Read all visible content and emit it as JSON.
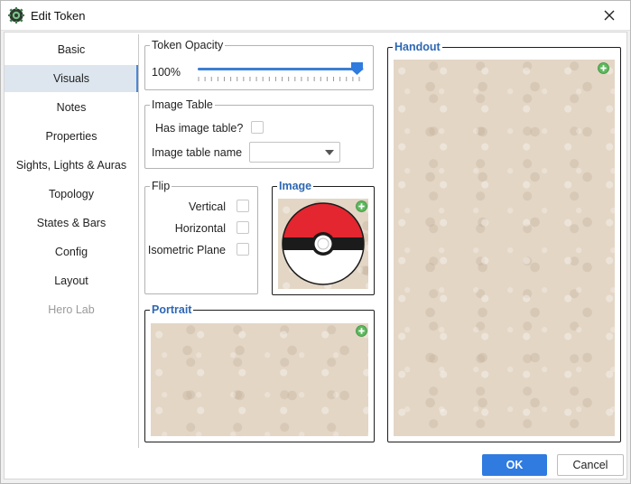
{
  "window": {
    "title": "Edit Token"
  },
  "sidebar": {
    "items": [
      {
        "label": "Basic"
      },
      {
        "label": "Visuals"
      },
      {
        "label": "Notes"
      },
      {
        "label": "Properties"
      },
      {
        "label": "Sights, Lights & Auras"
      },
      {
        "label": "Topology"
      },
      {
        "label": "States & Bars"
      },
      {
        "label": "Config"
      },
      {
        "label": "Layout"
      },
      {
        "label": "Hero Lab"
      }
    ],
    "active": "Visuals",
    "disabled": [
      "Hero Lab"
    ]
  },
  "opacity": {
    "title": "Token Opacity",
    "value_label": "100%",
    "value": 1.0
  },
  "image_table": {
    "title": "Image Table",
    "has_label": "Has image table?",
    "has_checked": false,
    "name_label": "Image table name",
    "name_value": ""
  },
  "flip": {
    "title": "Flip",
    "vertical_label": "Vertical",
    "horizontal_label": "Horizontal",
    "isometric_label": "Isometric Plane",
    "vertical_checked": false,
    "horizontal_checked": false,
    "isometric_checked": false
  },
  "image": {
    "title": "Image"
  },
  "portrait": {
    "title": "Portrait"
  },
  "handout": {
    "title": "Handout"
  },
  "buttons": {
    "ok": "OK",
    "cancel": "Cancel"
  },
  "colors": {
    "accent": "#2f7be0",
    "section_title": "#2e67b3",
    "active_nav_bg": "#dde6ef",
    "parchment": "#e3d6c5"
  },
  "icons": {
    "app": "gear-token-icon",
    "close": "close-icon",
    "add": "plus-circle-icon",
    "dropdown": "chevron-down-icon"
  }
}
